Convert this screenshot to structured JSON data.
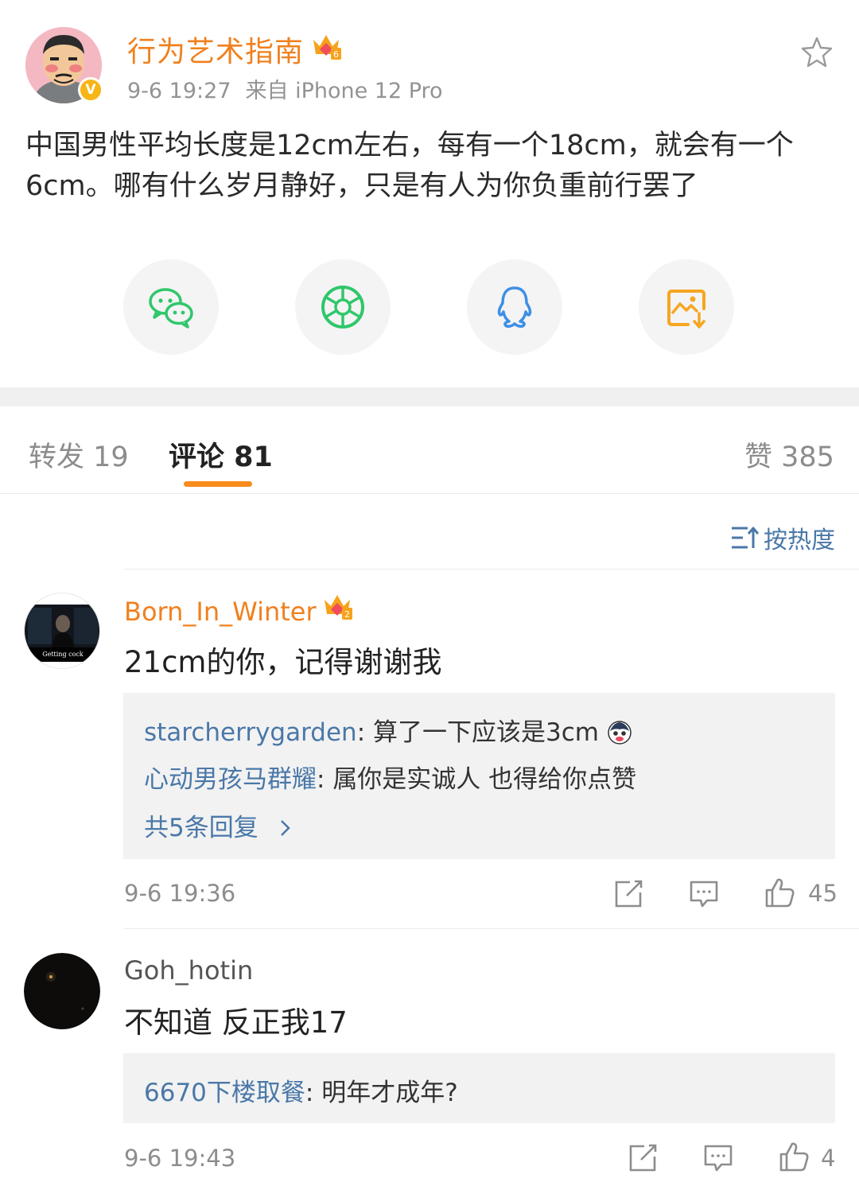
{
  "post": {
    "author": "行为艺术指南",
    "time": "9-6 19:27",
    "source": "来自 iPhone 12 Pro",
    "text": "中国男性平均长度是12cm左右，每有一个18cm，就会有一个6cm。哪有什么岁月静好，只是有人为你负重前行罢了",
    "verified_mark": "V",
    "level_badge": "6"
  },
  "share": {
    "items": [
      {
        "name": "wechat-icon"
      },
      {
        "name": "moments-icon"
      },
      {
        "name": "qq-icon"
      },
      {
        "name": "save-image-icon"
      }
    ]
  },
  "tabs": {
    "repost": "转发 19",
    "comments": "评论 81",
    "likes": "赞 385"
  },
  "sort": {
    "label": "按热度"
  },
  "comments": [
    {
      "user": "Born_In_Winter",
      "avatar_caption": "Getting cock",
      "level_badge": "2",
      "text": "21cm的你，记得谢谢我",
      "replies": [
        {
          "user": "starcherrygarden",
          "sep": ": ",
          "text": "算了一下应该是3cm"
        },
        {
          "user": "心动男孩马群耀",
          "sep": ": ",
          "text": "属你是实诚人 也得给你点赞"
        }
      ],
      "more": "共5条回复",
      "time": "9-6 19:36",
      "likes": "45"
    },
    {
      "user": "Goh_hotin",
      "text": "不知道 反正我17",
      "replies": [
        {
          "user": "6670下楼取餐",
          "sep": ": ",
          "text": "明年才成年?"
        }
      ],
      "time": "9-6 19:43",
      "likes": "4"
    }
  ],
  "colors": {
    "brand_orange": "#f0801e",
    "link_blue": "#4a78a8",
    "tab_underline": "#f78b1b",
    "wechat_green": "#2fc76b",
    "qq_blue": "#3d8fe6",
    "save_orange": "#f5a623"
  }
}
